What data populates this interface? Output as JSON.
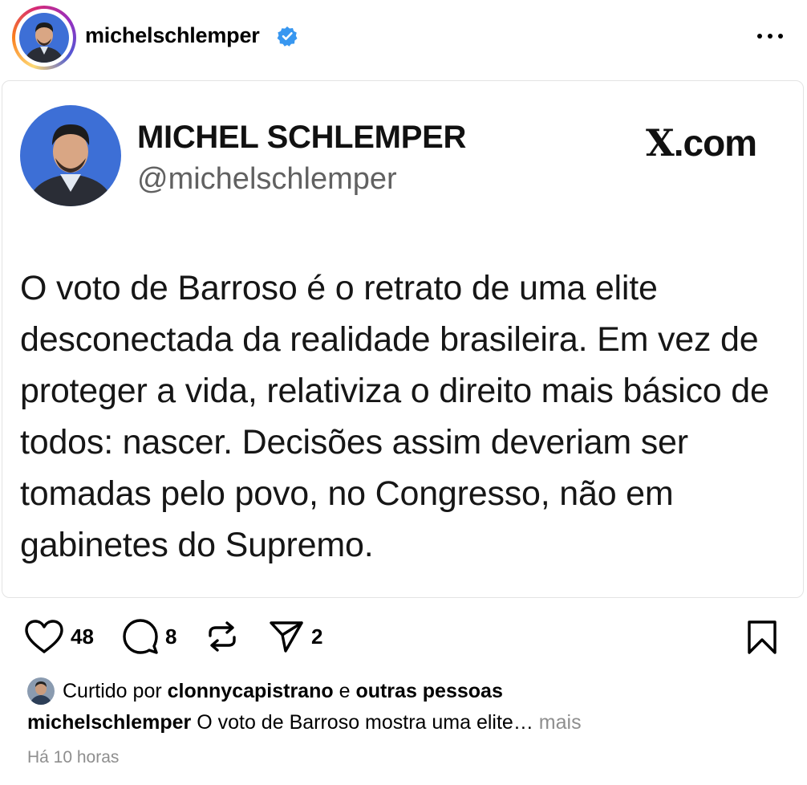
{
  "header": {
    "username": "michelschlemper",
    "verified_color": "#3897f0"
  },
  "tweet": {
    "name": "MICHEL SCHLEMPER",
    "handle": "@michelschlemper",
    "source_prefix": "X",
    "source_suffix": ".com",
    "text": "O voto de Barroso é o retrato de uma elite desconectada da realidade brasileira. Em vez de proteger a vida, relativiza o direito mais básico de todos: nascer. Decisões assim deveriam ser tomadas pelo povo, no Congresso, não em gabinetes do Supremo."
  },
  "actions": {
    "likes": "48",
    "comments": "8",
    "shares": "2",
    "icons": [
      "heart-icon",
      "comment-icon",
      "repost-icon",
      "send-icon",
      "bookmark-icon"
    ]
  },
  "footer": {
    "liked_prefix": "Curtido por",
    "liked_user": "clonnycapistrano",
    "liked_and": "e",
    "liked_others": "outras pessoas",
    "caption_user": "michelschlemper",
    "caption_text": "O voto de Barroso mostra uma elite…",
    "caption_more": "mais",
    "timestamp": "Há 10 horas"
  },
  "colors": {
    "avatar_bg": "#3d6fd6",
    "muted_text": "#8e8e8e",
    "handle_text": "#616161"
  }
}
